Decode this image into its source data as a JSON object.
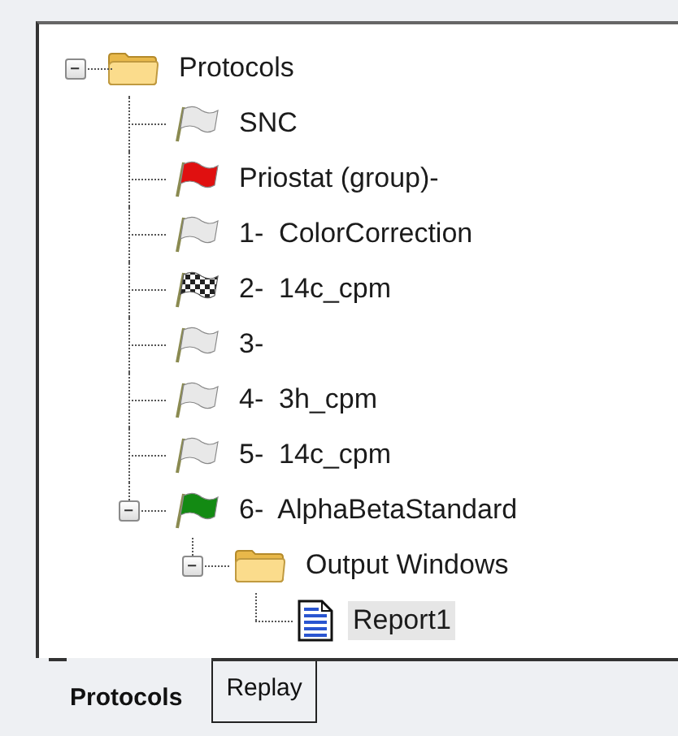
{
  "tree": [
    {
      "label": "Protocols",
      "kind": "folder",
      "expanded": true,
      "selected": false,
      "children": [
        {
          "label": "SNC",
          "kind": "flag",
          "color": "#e8e8e8",
          "selected": false
        },
        {
          "label": "Priostat (group)-",
          "kind": "flag",
          "color": "#e01010",
          "selected": false
        },
        {
          "label": "1-  ColorCorrection",
          "kind": "flag",
          "color": "#e8e8e8",
          "selected": false
        },
        {
          "label": "2-  14c_cpm",
          "kind": "checkered-flag",
          "selected": false
        },
        {
          "label": "3-",
          "kind": "flag",
          "color": "#e8e8e8",
          "selected": false
        },
        {
          "label": "4-  3h_cpm",
          "kind": "flag",
          "color": "#e8e8e8",
          "selected": false
        },
        {
          "label": "5-  14c_cpm",
          "kind": "flag",
          "color": "#e8e8e8",
          "selected": false
        },
        {
          "label": "6-  AlphaBetaStandard",
          "kind": "flag",
          "color": "#138a13",
          "expanded": true,
          "selected": false,
          "children": [
            {
              "label": "Output Windows",
              "kind": "folder",
              "expanded": true,
              "selected": false,
              "children": [
                {
                  "label": "Report1",
                  "kind": "document",
                  "selected": true
                }
              ]
            }
          ]
        }
      ]
    }
  ],
  "tabs": [
    {
      "label": "Protocols",
      "selected": true
    },
    {
      "label": "Replay",
      "selected": false
    }
  ]
}
